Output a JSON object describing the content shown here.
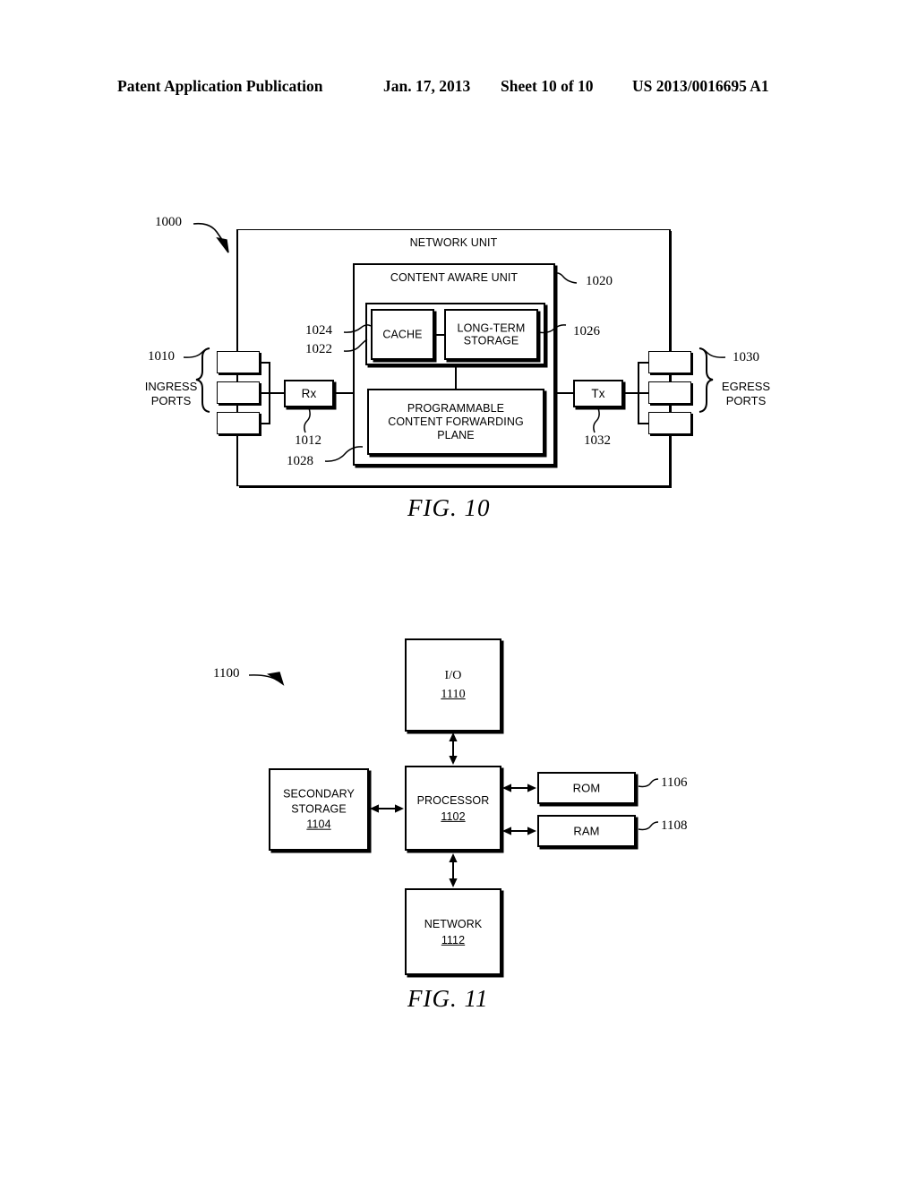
{
  "header": {
    "left": "Patent Application Publication",
    "date": "Jan. 17, 2013",
    "sheet": "Sheet 10 of 10",
    "pub_number": "US 2013/0016695 A1"
  },
  "fig10": {
    "caption": "FIG. 10",
    "ref_1000": "1000",
    "outer_label": "NETWORK UNIT",
    "content_aware_unit": {
      "label": "CONTENT AWARE UNIT",
      "ref": "1020"
    },
    "storage_group": {
      "ref": "1022"
    },
    "cache": {
      "label": "CACHE",
      "ref": "1024"
    },
    "long_term_storage": {
      "label_line1": "LONG-TERM",
      "label_line2": "STORAGE",
      "ref": "1026"
    },
    "forwarding_plane": {
      "label_line1": "PROGRAMMABLE",
      "label_line2": "CONTENT FORWARDING",
      "label_line3": "PLANE",
      "ref": "1028"
    },
    "rx": {
      "label": "Rx",
      "ref": "1012"
    },
    "tx": {
      "label": "Tx",
      "ref": "1032"
    },
    "ingress_ports": {
      "ref": "1010",
      "label_line1": "INGRESS",
      "label_line2": "PORTS",
      "count": 3
    },
    "egress_ports": {
      "ref": "1030",
      "label_line1": "EGRESS",
      "label_line2": "PORTS",
      "count": 3
    }
  },
  "fig11": {
    "caption": "FIG. 11",
    "ref_1100": "1100",
    "blocks": [
      {
        "key": "io",
        "label": "I/O",
        "number": "1110",
        "number_inside": true
      },
      {
        "key": "secondary_storage",
        "label_line1": "SECONDARY",
        "label_line2": "STORAGE",
        "number": "1104",
        "number_inside": true
      },
      {
        "key": "processor",
        "label": "PROCESSOR",
        "number": "1102",
        "number_inside": true
      },
      {
        "key": "rom",
        "label": "ROM",
        "number": "1106",
        "number_inside": false
      },
      {
        "key": "ram",
        "label": "RAM",
        "number": "1108",
        "number_inside": false
      },
      {
        "key": "network",
        "label": "NETWORK",
        "number": "1112",
        "number_inside": true
      }
    ]
  }
}
